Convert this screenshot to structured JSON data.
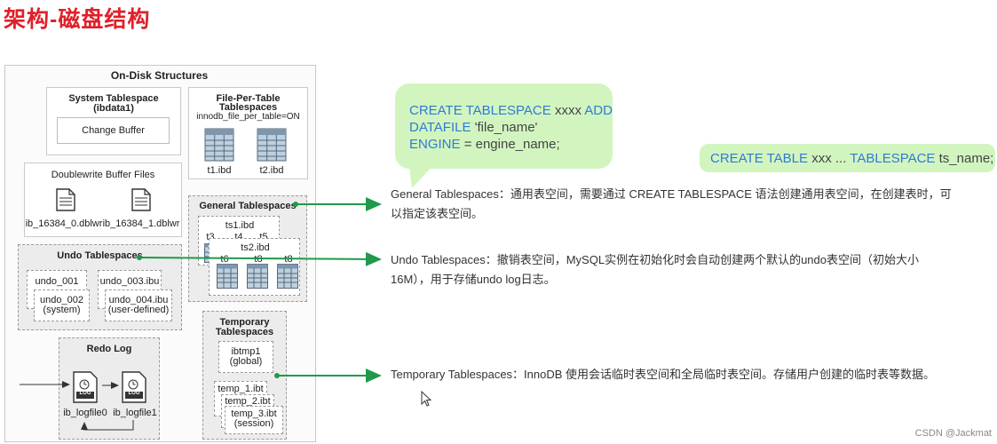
{
  "page_title": "架构-磁盘结构",
  "diagram": {
    "title": "On-Disk Structures",
    "system_tablespace": {
      "title": "System Tablespace",
      "subtitle": "(ibdata1)",
      "change_buffer": "Change Buffer"
    },
    "file_per_table": {
      "title_line1": "File-Per-Table",
      "title_line2": "Tablespaces",
      "setting": "innodb_file_per_table=ON",
      "files": [
        "t1.ibd",
        "t2.ibd"
      ]
    },
    "doublewrite": {
      "title": "Doublewrite Buffer Files",
      "files": [
        "ib_16384_0.dblwr",
        "ib_16384_1.dblwr"
      ]
    },
    "general": {
      "title": "General Tablespaces",
      "ts1": "ts1.ibd",
      "ts1_tables": [
        "t3",
        "t4",
        "t5"
      ],
      "ts2": "ts2.ibd",
      "ts2_tables": [
        "t6",
        "t8",
        "t8"
      ]
    },
    "undo": {
      "title": "Undo Tablespaces",
      "files": [
        {
          "name": "undo_001",
          "back": true
        },
        {
          "name": "undo_002",
          "note": "(system)"
        },
        {
          "name": "undo_003.ibu",
          "back": true
        },
        {
          "name": "undo_004.ibu",
          "note": "(user-defined)"
        }
      ]
    },
    "redo": {
      "title": "Redo Log",
      "files": [
        "ib_logfile0",
        "ib_logfile1"
      ],
      "icon_text": "LOG"
    },
    "temporary": {
      "title_line1": "Temporary",
      "title_line2": "Tablespaces",
      "global_name": "ibtmp1",
      "global_note": "(global)",
      "session_files": [
        "temp_1.ibt",
        "temp_2.ibt",
        "temp_3.ibt"
      ],
      "session_note": "(session)"
    }
  },
  "bubbles": {
    "create_tablespace": {
      "line1_kw1": "CREATE TABLESPACE",
      "line1_arg": "xxxx",
      "line1_kw2": "ADD",
      "line2_kw": "DATAFILE",
      "line2_arg": "'file_name'",
      "line3_kw": "ENGINE",
      "line3_arg": "= engine_name;"
    },
    "create_table": {
      "kw1": "CREATE TABLE",
      "arg1": "xxx ...",
      "kw2": "TABLESPACE",
      "arg2": "ts_name;"
    }
  },
  "descriptions": {
    "general_line1": "General Tablespaces：通用表空间，需要通过 CREATE TABLESPACE 语法创建通用表空间，在创建表时，可",
    "general_line2": "以指定该表空间。",
    "undo_line1": "Undo Tablespaces：撤销表空间，MySQL实例在初始化时会自动创建两个默认的undo表空间（初始大小",
    "undo_line2": "16M），用于存储undo log日志。",
    "temporary": "Temporary Tablespaces：InnoDB 使用会话临时表空间和全局临时表空间。存储用户创建的临时表等数据。"
  },
  "colors": {
    "title": "#e0202a",
    "bubble": "#d2f5c0",
    "keyword": "#2f7bd3",
    "arrow": "#1f9a4b"
  },
  "watermark": "CSDN @Jackmat"
}
